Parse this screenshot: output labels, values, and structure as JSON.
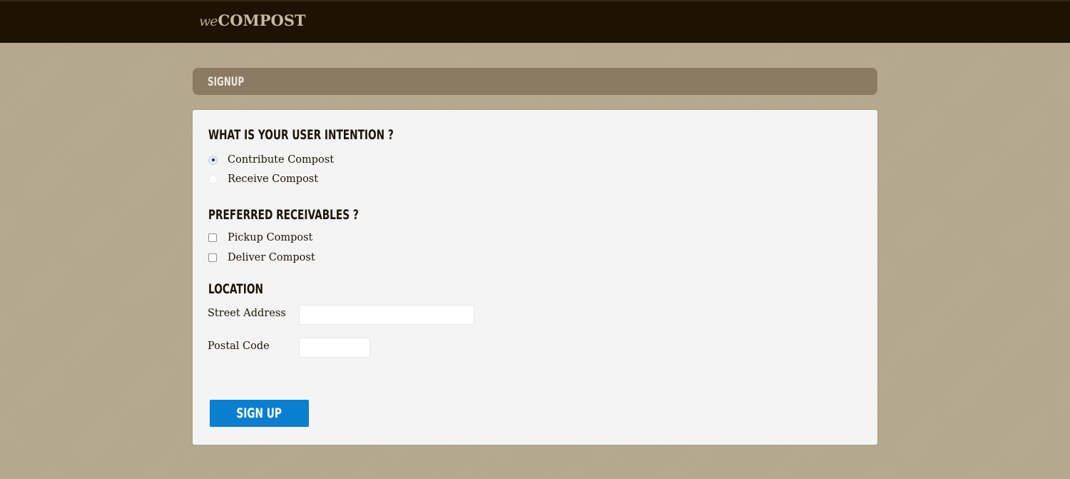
{
  "header": {
    "logo_prefix": "we",
    "logo_name": "COMPOST"
  },
  "page": {
    "title": "SIGNUP"
  },
  "form": {
    "intention": {
      "title": "WHAT IS YOUR USER INTENTION ?",
      "options": [
        {
          "label": "Contribute Compost",
          "selected": true
        },
        {
          "label": "Receive Compost",
          "selected": false
        }
      ]
    },
    "receivables": {
      "title": "PREFERRED RECEIVABLES ?",
      "options": [
        {
          "label": "Pickup Compost",
          "checked": false
        },
        {
          "label": "Deliver Compost",
          "checked": false
        }
      ]
    },
    "location": {
      "title": "LOCATION",
      "street_label": "Street Address",
      "street_value": "",
      "postal_label": "Postal Code",
      "postal_value": ""
    },
    "submit_label": "SIGN UP"
  },
  "colors": {
    "topbar": "#1c1304",
    "background": "#b6a98f",
    "header_bar": "#8b7b65",
    "card": "#f4f4f4",
    "button": "#0a7fcf"
  }
}
